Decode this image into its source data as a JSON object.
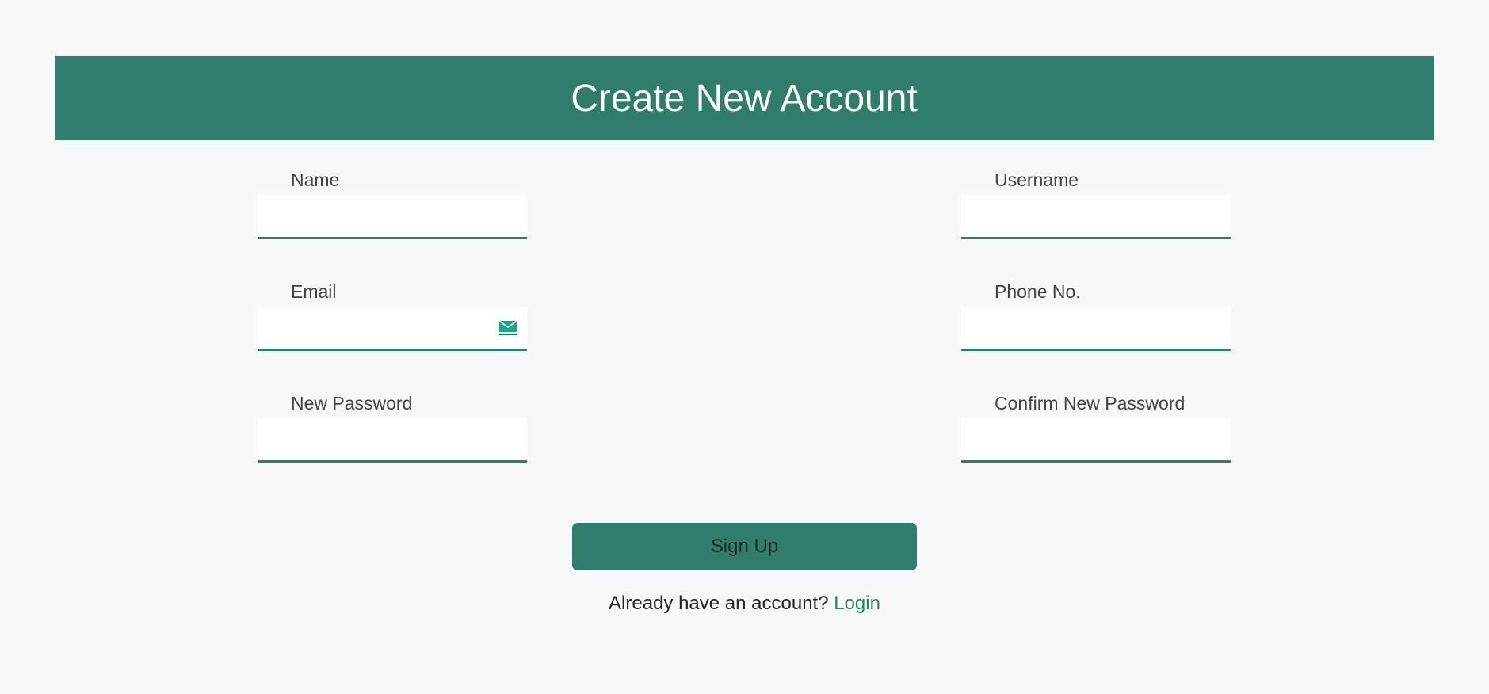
{
  "header": {
    "title": "Create New Account"
  },
  "fields": {
    "name": {
      "label": "Name",
      "value": "",
      "placeholder": ""
    },
    "username": {
      "label": "Username",
      "value": "",
      "placeholder": ""
    },
    "email": {
      "label": "Email",
      "value": "",
      "placeholder": "",
      "icon": "mail-icon"
    },
    "phone": {
      "label": "Phone No.",
      "value": "",
      "placeholder": ""
    },
    "new_password": {
      "label": "New Password",
      "value": "",
      "placeholder": ""
    },
    "confirm_password": {
      "label": "Confirm New Password",
      "value": "",
      "placeholder": ""
    }
  },
  "actions": {
    "signup_label": "Sign Up",
    "login_prompt": "Already have an account?",
    "login_link": "Login"
  },
  "colors": {
    "accent": "#2f7d6a",
    "background": "#f7f8fa",
    "label_text": "#404448"
  }
}
